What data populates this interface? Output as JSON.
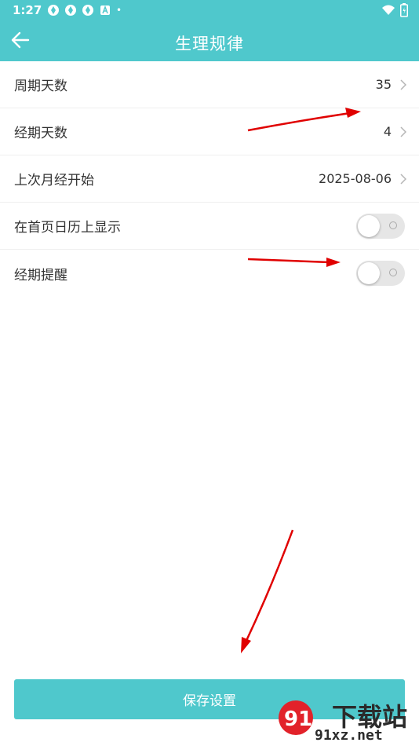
{
  "status_bar": {
    "time": "1:27",
    "dot": "•"
  },
  "header": {
    "title": "生理规律"
  },
  "rows": [
    {
      "label": "周期天数",
      "value": "35"
    },
    {
      "label": "经期天数",
      "value": "4"
    },
    {
      "label": "上次月经开始",
      "value": "2025-08-06"
    },
    {
      "label": "在首页日历上显示",
      "toggle_on": false
    },
    {
      "label": "经期提醒",
      "toggle_on": false
    }
  ],
  "save_button": {
    "label": "保存设置"
  },
  "watermark": {
    "text1": "下载站",
    "text2": "91xz.net",
    "logo_text": "91"
  },
  "colors": {
    "accent": "#4fc8cc",
    "annotation_arrow": "#e00000"
  }
}
